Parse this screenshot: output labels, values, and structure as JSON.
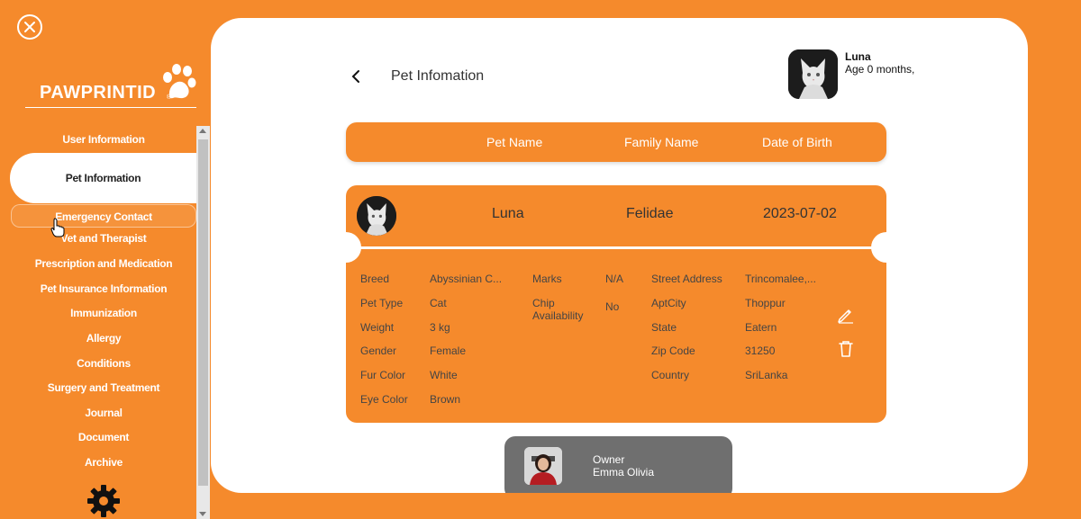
{
  "app": {
    "brand": "PAWPRINTID",
    "brand_mark": "®"
  },
  "sidebar": {
    "items": [
      {
        "label": "User Information"
      },
      {
        "label": "Pet Information"
      },
      {
        "label": "Emergency Contact"
      },
      {
        "label": "Vet and Therapist"
      },
      {
        "label": "Prescription and Medication"
      },
      {
        "label": "Pet Insurance Information"
      },
      {
        "label": "Immunization"
      },
      {
        "label": "Allergy"
      },
      {
        "label": "Conditions"
      },
      {
        "label": "Surgery and Treatment"
      },
      {
        "label": "Journal"
      },
      {
        "label": "Document"
      },
      {
        "label": "Archive"
      }
    ],
    "active": "Pet Information"
  },
  "page": {
    "title": "Pet Infomation",
    "pet_name": "Luna",
    "pet_age": "Age 0 months,"
  },
  "table": {
    "headers": [
      "Pet Name",
      "Family Name",
      "Date of Birth"
    ]
  },
  "pet": {
    "name": "Luna",
    "family": "Felidae",
    "dob": "2023-07-02",
    "details": {
      "breed_label": "Breed",
      "breed": "Abyssinian C...",
      "type_label": "Pet Type",
      "type": "Cat",
      "weight_label": "Weight",
      "weight": "3 kg",
      "gender_label": "Gender",
      "gender": "Female",
      "fur_label": "Fur Color",
      "fur": "White",
      "eye_label": "Eye Color",
      "eye": "Brown",
      "marks_label": "Marks",
      "marks": "N/A",
      "chip_label_1": "Chip",
      "chip_label_2": "Availability",
      "chip": "No",
      "street_label": "Street Address",
      "street": "Trincomalee,...",
      "aptcity_label": "AptCity",
      "aptcity": "Thoppur",
      "state_label": "State",
      "state": "Eatern",
      "zip_label": "Zip Code",
      "zip": "31250",
      "country_label": "Country",
      "country": "SriLanka"
    }
  },
  "owner": {
    "label": "Owner",
    "name": "Emma Olivia"
  },
  "colors": {
    "accent": "#f58a2c",
    "panel": "#ffffff",
    "owner_card": "#6f6f6f"
  },
  "icons": [
    "close-icon",
    "paw-icon",
    "back-chevron-icon",
    "edit-pencil-icon",
    "trash-icon",
    "settings-gear-icon",
    "hand-cursor-icon"
  ]
}
